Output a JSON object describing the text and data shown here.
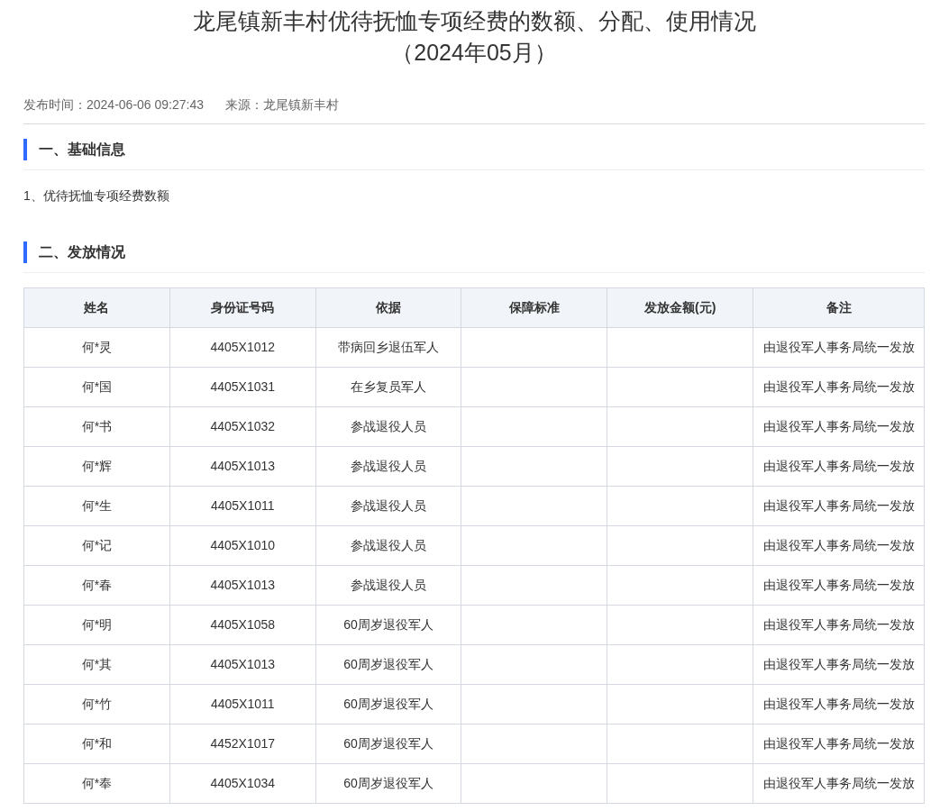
{
  "title": [
    "龙尾镇新丰村优待抚恤专项经费的数额、分配、使用情况",
    "（2024年05月）"
  ],
  "meta": {
    "publish_time": "发布时间：2024-06-06 09:27:43",
    "source": "来源：龙尾镇新丰村"
  },
  "sections": [
    {
      "heading": "一、基础信息",
      "paragraphs": [
        "1、优待抚恤专项经费数额"
      ]
    },
    {
      "heading": "二、发放情况"
    }
  ],
  "table": {
    "columns": [
      "姓名",
      "身份证号码",
      "依据",
      "保障标准",
      "发放金额(元)",
      "备注"
    ],
    "rows": [
      {
        "name": "何*灵",
        "id_number": "4405X1012",
        "basis": "带病回乡退伍军人",
        "note": "由退役军人事务局统一发放"
      },
      {
        "name": "何*国",
        "id_number": "4405X1031",
        "basis": "在乡复员军人",
        "note": "由退役军人事务局统一发放"
      },
      {
        "name": "何*书",
        "id_number": "4405X1032",
        "basis": "参战退役人员",
        "note": "由退役军人事务局统一发放"
      },
      {
        "name": "何*辉",
        "id_number": "4405X1013",
        "basis": "参战退役人员",
        "note": "由退役军人事务局统一发放"
      },
      {
        "name": "何*生",
        "id_number": "4405X1011",
        "basis": "参战退役人员",
        "note": "由退役军人事务局统一发放"
      },
      {
        "name": "何*记",
        "id_number": "4405X1010",
        "basis": "参战退役人员",
        "note": "由退役军人事务局统一发放"
      },
      {
        "name": "何*春",
        "id_number": "4405X1013",
        "basis": "参战退役人员",
        "note": "由退役军人事务局统一发放"
      },
      {
        "name": "何*明",
        "id_number": "4405X1058",
        "basis": "60周岁退役军人",
        "note": "由退役军人事务局统一发放"
      },
      {
        "name": "何*其",
        "id_number": "4405X1013",
        "basis": "60周岁退役军人",
        "note": "由退役军人事务局统一发放"
      },
      {
        "name": "何*竹",
        "id_number": "4405X1011",
        "basis": "60周岁退役军人",
        "note": "由退役军人事务局统一发放"
      },
      {
        "name": "何*和",
        "id_number": "4452X1017",
        "basis": "60周岁退役军人",
        "note": "由退役军人事务局统一发放"
      },
      {
        "name": "何*奉",
        "id_number": "4405X1034",
        "basis": "60周岁退役军人",
        "note": "由退役军人事务局统一发放"
      }
    ]
  }
}
